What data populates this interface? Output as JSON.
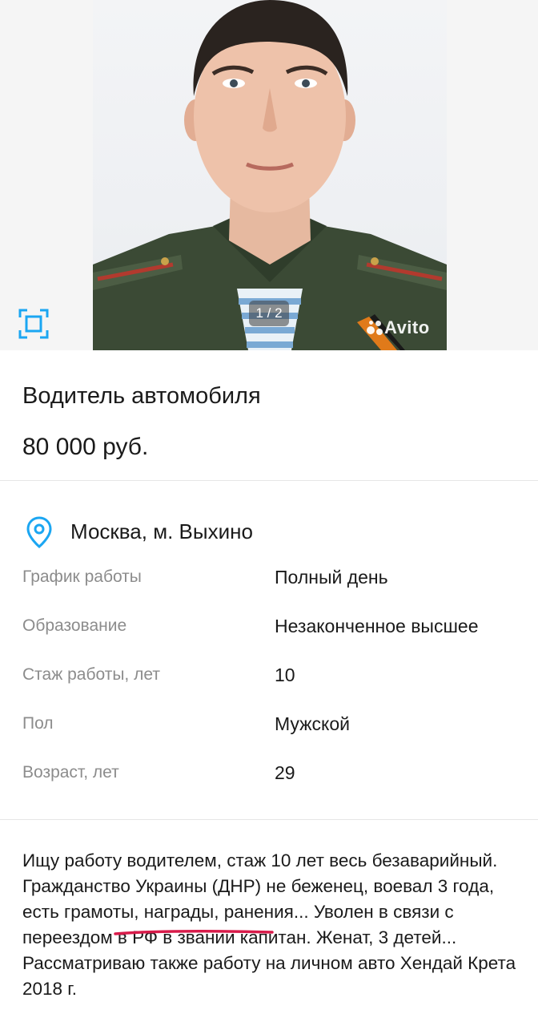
{
  "gallery": {
    "counter": "1 / 2",
    "watermark": "Avito",
    "icons": {
      "fullscreen": "fullscreen-icon",
      "location": "location-pin-icon"
    },
    "accent_color": "#00aaff"
  },
  "listing": {
    "title": "Водитель автомобиля",
    "price": "80 000 руб.",
    "location": "Москва, м. Выхино"
  },
  "params": [
    {
      "label": "График работы",
      "value": "Полный день"
    },
    {
      "label": "Образование",
      "value": "Незаконченное высшее"
    },
    {
      "label": "Стаж работы, лет",
      "value": "10"
    },
    {
      "label": "Пол",
      "value": "Мужской"
    },
    {
      "label": "Возраст, лет",
      "value": "29"
    }
  ],
  "description": {
    "part1": "Ищу работу водителем, стаж 10 лет весь безаварийный. Гражданство Украины (ДНР) не беженец, ",
    "highlight": "воевал 3 года,",
    "part2": " есть грамоты, награды, ранения... Уволен в связи с переездом в РФ в звании капитан. Женат, 3 детей... Рассматриваю также работу на личном авто Хендай Крета 2018 г.",
    "highlight_color": "#d81b4a"
  }
}
